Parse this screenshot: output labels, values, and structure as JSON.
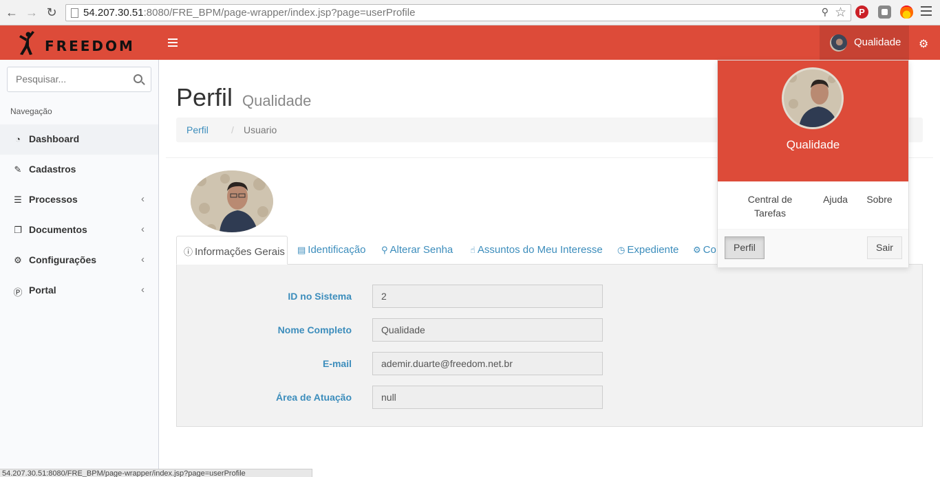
{
  "browser": {
    "url_host": "54.207.30.51",
    "url_rest": ":8080/FRE_BPM/page-wrapper/index.jsp?page=userProfile",
    "status_text": "54.207.30.51:8080/FRE_BPM/page-wrapper/index.jsp?page=userProfile"
  },
  "header": {
    "logo_text": "FREEDOM",
    "user_name": "Qualidade",
    "accent_color": "#dd4b39"
  },
  "sidebar": {
    "search_placeholder": "Pesquisar...",
    "nav_header": "Navegação",
    "items": [
      {
        "label": "Dashboard",
        "icon": "dashboard-icon",
        "active": true,
        "has_children": false
      },
      {
        "label": "Cadastros",
        "icon": "pencil-icon",
        "active": false,
        "has_children": false
      },
      {
        "label": "Processos",
        "icon": "list-icon",
        "active": false,
        "has_children": true
      },
      {
        "label": "Documentos",
        "icon": "documents-icon",
        "active": false,
        "has_children": true
      },
      {
        "label": "Configurações",
        "icon": "gears-icon",
        "active": false,
        "has_children": true
      },
      {
        "label": "Portal",
        "icon": "pinterest-icon",
        "active": false,
        "has_children": true
      }
    ]
  },
  "page": {
    "title": "Perfil",
    "subtitle": "Qualidade",
    "breadcrumb": {
      "link": "Perfil",
      "current": "Usuario"
    }
  },
  "tabs": [
    {
      "label": "Informações Gerais",
      "icon": "info-icon",
      "active": true
    },
    {
      "label": "Identificação",
      "icon": "id-card-icon",
      "active": false
    },
    {
      "label": "Alterar Senha",
      "icon": "key-icon",
      "active": false
    },
    {
      "label": "Assuntos do Meu Interesse",
      "icon": "thumbs-up-icon",
      "active": false
    },
    {
      "label": "Expediente",
      "icon": "clock-icon",
      "active": false
    },
    {
      "label": "Co",
      "icon": "gears-icon",
      "active": false
    }
  ],
  "form": {
    "fields": [
      {
        "label": "ID no Sistema",
        "value": "2"
      },
      {
        "label": "Nome Completo",
        "value": "Qualidade"
      },
      {
        "label": "E-mail",
        "value": "ademir.duarte@freedom.net.br"
      },
      {
        "label": "Área de Atuação",
        "value": "null"
      }
    ]
  },
  "dropdown": {
    "name": "Qualidade",
    "links": {
      "central": "Central de Tarefas",
      "central_l1": "Central de",
      "central_l2": "Tarefas",
      "ajuda": "Ajuda",
      "sobre": "Sobre"
    },
    "profile_button": "Perfil",
    "logout_button": "Sair"
  }
}
